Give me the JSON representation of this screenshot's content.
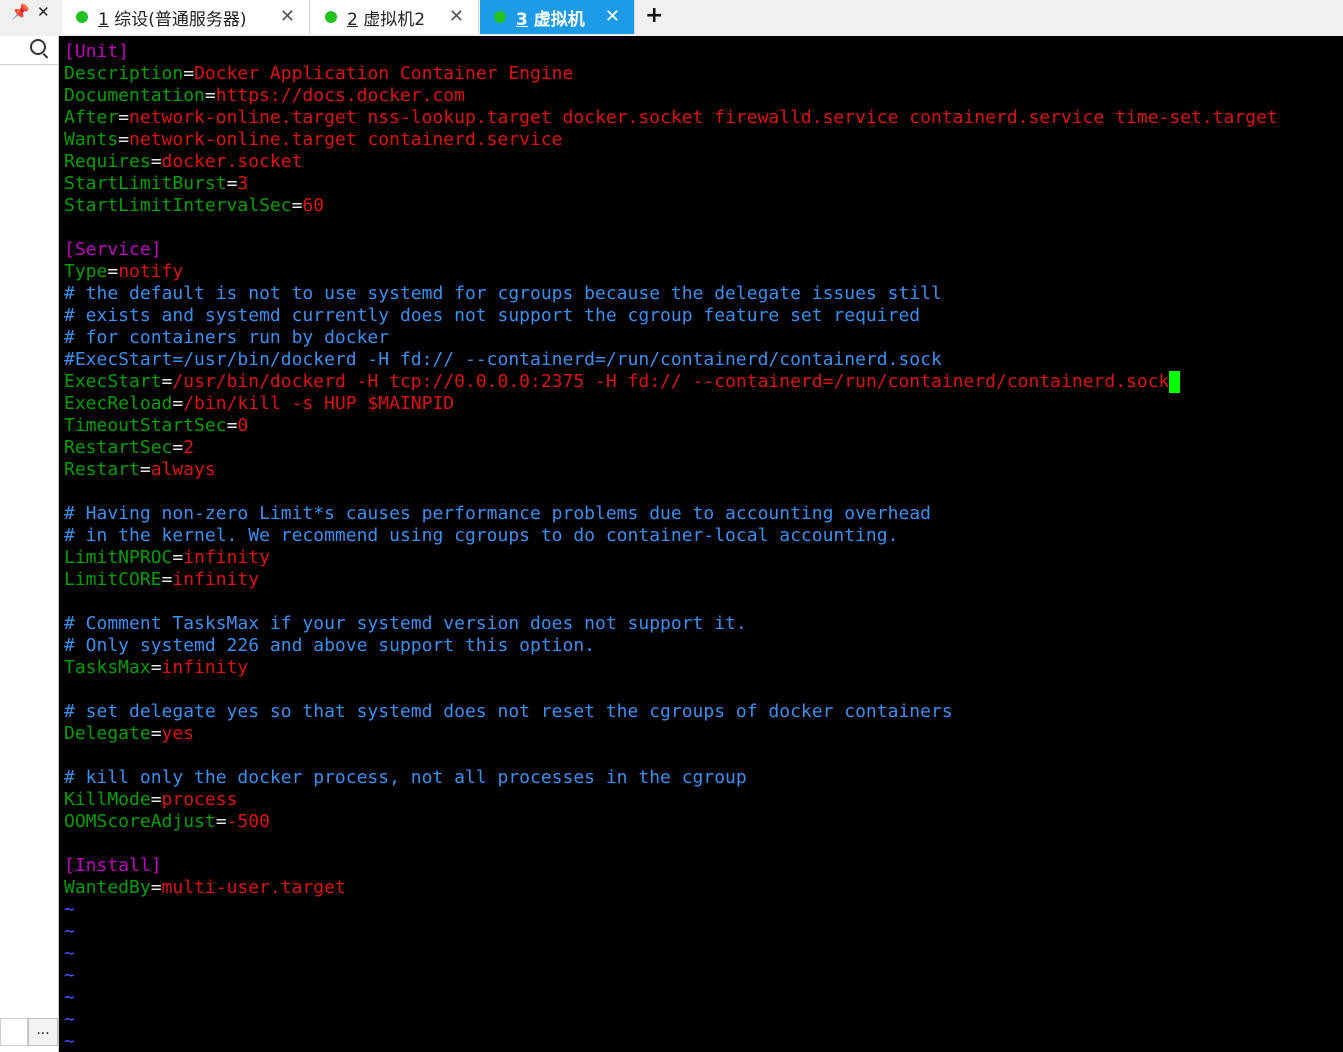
{
  "tabs": [
    {
      "num": "1",
      "label": "综设(普通服务器)"
    },
    {
      "num": "2",
      "label": "虚拟机2"
    },
    {
      "num": "3",
      "label": "虚拟机"
    }
  ],
  "tab_close_glyph": "✕",
  "new_tab_glyph": "+",
  "panel_controls": {
    "pin": "📌",
    "close": "✕"
  },
  "sidebar": {
    "more_label": "..."
  },
  "colors": {
    "section": "#c000c0",
    "key": "#00a000",
    "equals": "#e8e8e8",
    "value": "#e01010",
    "comment": "#3a8ff0",
    "tilde": "#4455ff",
    "cursor": "#00ff00",
    "active_tab": "#1d9be6",
    "status_dot": "#22c122"
  },
  "terminal": {
    "lines": [
      "[Unit]",
      "Description=Docker Application Container Engine",
      "Documentation=https://docs.docker.com",
      "After=network-online.target nss-lookup.target docker.socket firewalld.service containerd.service time-set.target",
      "Wants=network-online.target containerd.service",
      "Requires=docker.socket",
      "StartLimitBurst=3",
      "StartLimitIntervalSec=60",
      "",
      "[Service]",
      "Type=notify",
      "# the default is not to use systemd for cgroups because the delegate issues still",
      "# exists and systemd currently does not support the cgroup feature set required",
      "# for containers run by docker",
      "#ExecStart=/usr/bin/dockerd -H fd:// --containerd=/run/containerd/containerd.sock",
      "ExecStart=/usr/bin/dockerd -H tcp://0.0.0.0:2375 -H fd:// --containerd=/run/containerd/containerd.sock",
      "ExecReload=/bin/kill -s HUP $MAINPID",
      "TimeoutStartSec=0",
      "RestartSec=2",
      "Restart=always",
      "",
      "# Having non-zero Limit*s causes performance problems due to accounting overhead",
      "# in the kernel. We recommend using cgroups to do container-local accounting.",
      "LimitNPROC=infinity",
      "LimitCORE=infinity",
      "",
      "# Comment TasksMax if your systemd version does not support it.",
      "# Only systemd 226 and above support this option.",
      "TasksMax=infinity",
      "",
      "# set delegate yes so that systemd does not reset the cgroups of docker containers",
      "Delegate=yes",
      "",
      "# kill only the docker process, not all processes in the cgroup",
      "KillMode=process",
      "OOMScoreAdjust=-500",
      "",
      "[Install]",
      "WantedBy=multi-user.target",
      "~",
      "~",
      "~",
      "~",
      "~",
      "~",
      "~"
    ],
    "cursor_line": 15
  }
}
